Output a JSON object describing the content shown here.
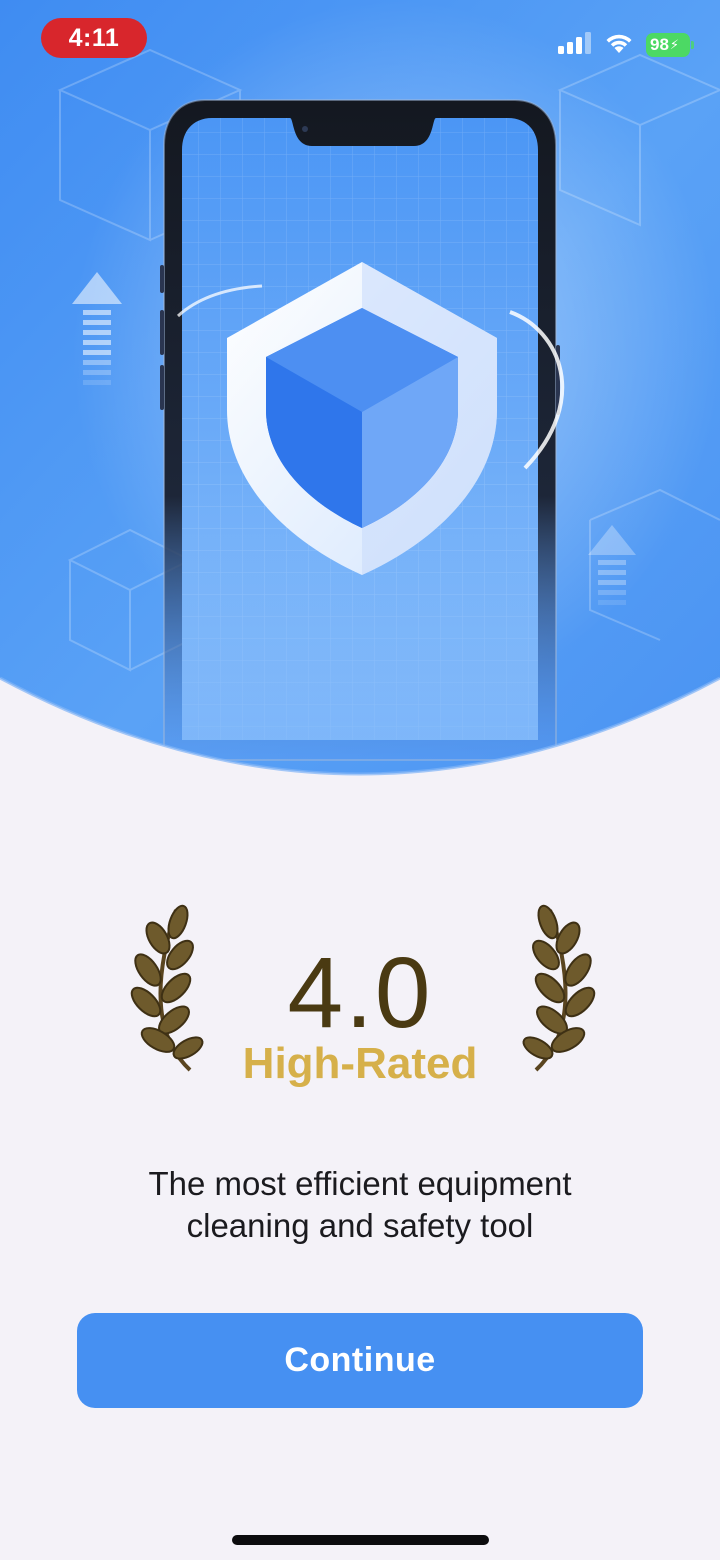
{
  "status_bar": {
    "time": "4:11",
    "battery": "98",
    "icons": [
      "signal-icon",
      "wifi-icon",
      "battery-charging-icon"
    ]
  },
  "hero": {
    "illustration": "phone-with-shield-icon"
  },
  "rating": {
    "value": "4.0",
    "label": "High-Rated"
  },
  "tagline": {
    "line1": "The most efficient equipment",
    "line2": "cleaning and safety tool"
  },
  "continue_label": "Continue",
  "colors": {
    "brand_blue": "#4690f2",
    "page_bg": "#f4f2f8",
    "rating_gold": "#d6b04a",
    "status_pill": "#d8262c"
  }
}
